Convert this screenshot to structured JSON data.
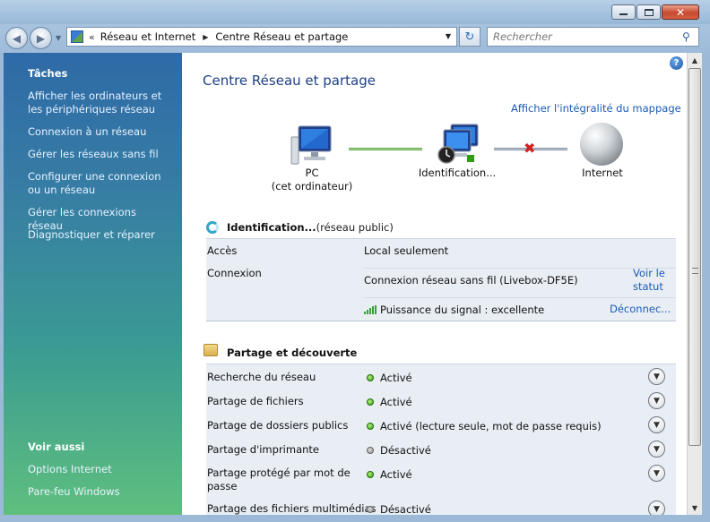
{
  "window": {
    "controls": {
      "minimize": "minimize-icon",
      "maximize": "maximize-icon",
      "close": "close-icon"
    }
  },
  "address_bar": {
    "prefix": "«",
    "crumbs": [
      "Réseau et Internet",
      "Centre Réseau et partage"
    ],
    "search_placeholder": "Rechercher"
  },
  "sidebar": {
    "tasks_title": "Tâches",
    "tasks": [
      "Afficher les ordinateurs et les périphériques réseau",
      "Connexion à un réseau",
      "Gérer les réseaux sans fil",
      "Configurer une connexion ou un réseau",
      "Gérer les connexions réseau",
      "Diagnostiquer et réparer"
    ],
    "see_also_title": "Voir aussi",
    "see_also": [
      "Options Internet",
      "Pare-feu Windows"
    ]
  },
  "main": {
    "title": "Centre Réseau et partage",
    "full_map_link": "Afficher l'intégralité du mappage",
    "map": {
      "pc_line1": "PC",
      "pc_line2": "(cet ordinateur)",
      "network": "Identification...",
      "internet": "Internet"
    },
    "network_section": {
      "name": "Identification...",
      "type": " (réseau public)",
      "access_label": "Accès",
      "access_value": "Local seulement",
      "connection_label": "Connexion",
      "connection_value": "Connexion réseau sans fil (Livebox-DF5E)",
      "view_status_link": "Voir le statut",
      "signal_value": "Puissance du signal : excellente",
      "disconnect_link": "Déconnec..."
    },
    "sharing_section": {
      "title": "Partage et découverte",
      "rows": [
        {
          "label": "Recherche du réseau",
          "status": "Activé",
          "on": true
        },
        {
          "label": "Partage de fichiers",
          "status": "Activé",
          "on": true
        },
        {
          "label": "Partage de dossiers publics",
          "status": "Activé (lecture seule, mot de passe requis)",
          "on": true
        },
        {
          "label": "Partage d'imprimante",
          "status": "Désactivé",
          "on": false
        },
        {
          "label": "Partage protégé par mot de passe",
          "status": "Activé",
          "on": true
        },
        {
          "label": "Partage des fichiers multimédias",
          "status": "Désactivé",
          "on": false
        }
      ]
    }
  },
  "colors": {
    "link": "#1a5bb6",
    "title": "#1e3f87",
    "status_on": "#2e9c14",
    "status_off": "#8b8b8b",
    "error_x": "#d42020"
  }
}
